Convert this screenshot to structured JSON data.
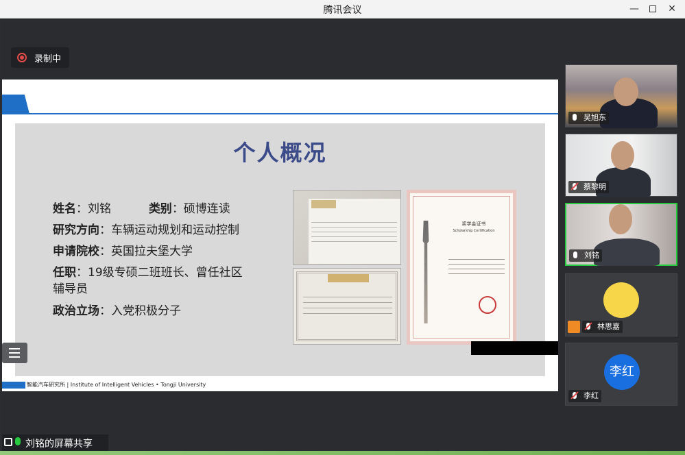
{
  "window": {
    "title": "腾讯会议"
  },
  "recording": {
    "label": "录制中"
  },
  "slide": {
    "heading": "个人概况",
    "rows": [
      {
        "key": "姓名",
        "value": "：刘铭",
        "key2": "类别",
        "value2": "：硕博连读"
      },
      {
        "key": "研究方向",
        "value": "：车辆运动规划和运动控制"
      },
      {
        "key": "申请院校",
        "value": "：英国拉夫堡大学"
      },
      {
        "key": "任职",
        "value": "：19级专硕二班班长、曾任社区",
        "cont": "辅导员"
      },
      {
        "key": "政治立场",
        "value": "：入党积极分子"
      }
    ],
    "certificate": {
      "title": "奖学金证书",
      "subtitle": "Scholarship Certification"
    },
    "footer": "智能汽车研究所 | Institute of Intelligent Vehicles • Tongji University"
  },
  "share": {
    "label": "刘铭的屏幕共享"
  },
  "participants": [
    {
      "name": "吴旭东",
      "muted": false
    },
    {
      "name": "蔡黎明",
      "muted": true
    },
    {
      "name": "刘铭",
      "muted": false,
      "active": true
    },
    {
      "name": "林思嘉",
      "muted": true
    },
    {
      "name": "李红",
      "muted": true,
      "avatar_text": "李红"
    }
  ],
  "colors": {
    "accent_blue": "#1f6fc6",
    "heading": "#3b4a88",
    "active_green": "#27c93f",
    "record_red": "#e34a4a"
  }
}
